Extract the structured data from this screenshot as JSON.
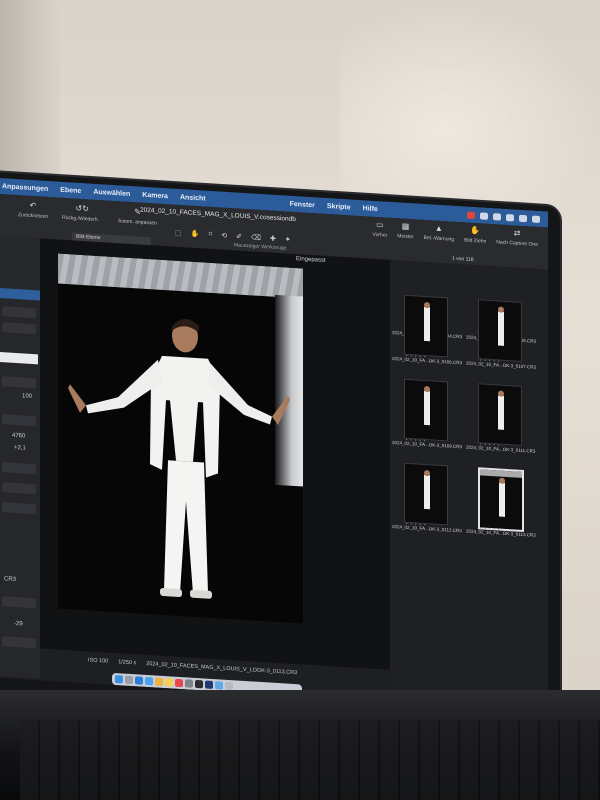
{
  "menubar": {
    "items": [
      "Anpassungen",
      "Ebene",
      "Auswählen",
      "Kamera",
      "Ansicht",
      "Fenster",
      "Skripte",
      "Hilfe"
    ]
  },
  "toolbar": {
    "file_title": "2024_02_10_FACES_MAG_X_LOUIS_V.cosessiondb",
    "reset_label": "Zurücksetzen",
    "undo_label": "Rückg./Wiederh.",
    "auto_adjust_label": "Autom. anpassen",
    "layer_label": "Bild-Ebene",
    "tools_label": "Mauszeiger Werkzeuge",
    "right_tools": [
      "Vorher",
      "Meister",
      "Bel.-Warnung",
      "Bild Ziehn",
      "Nach Capture One"
    ],
    "count_text": "1 von 118"
  },
  "left_panel": {
    "values": [
      "100",
      "4760",
      "+2,1",
      "CR3",
      "-29"
    ]
  },
  "viewer": {
    "fit_label": "Eingepasst",
    "iso_label": "ISO 100",
    "shutter_label": "1/250 s",
    "filename": "2024_02_10_FACES_MAG_X_LOUIS_V_LOOK-3_0113.CR3"
  },
  "filmstrip": {
    "items": [
      {
        "caption": "2024_02_10_FA...OK-3_0104.CR3",
        "selected": false
      },
      {
        "caption": "2024_02_10_FA...OK-3_0105.CR3",
        "selected": false
      },
      {
        "caption": "2024_02_10_FA...OK-3_0106.CR3",
        "selected": false
      },
      {
        "caption": "2024_02_10_FA...OK-3_0107.CR3",
        "selected": false
      },
      {
        "caption": "2024_02_10_FA...OK-3_0109.CR3",
        "selected": false
      },
      {
        "caption": "2024_02_10_FA...OK-3_0111.CR3",
        "selected": false
      },
      {
        "caption": "2024_02_10_FA...OK-3_0112.CR3",
        "selected": false
      },
      {
        "caption": "2024_02_10_FA...OK-3_0113.CR3",
        "selected": true
      }
    ]
  },
  "colors": {
    "menubar": "#2c5b9a",
    "toolbar": "#2a2b2f",
    "canvas": "#111214",
    "wall": "#d9d3cb"
  },
  "dock_icons": [
    "finder-icon",
    "launchpad-icon",
    "safari-icon",
    "mail-icon",
    "photos-icon",
    "notes-icon",
    "music-icon",
    "settings-icon",
    "capture-one-icon",
    "photoshop-icon",
    "folder-icon",
    "trash-icon"
  ]
}
